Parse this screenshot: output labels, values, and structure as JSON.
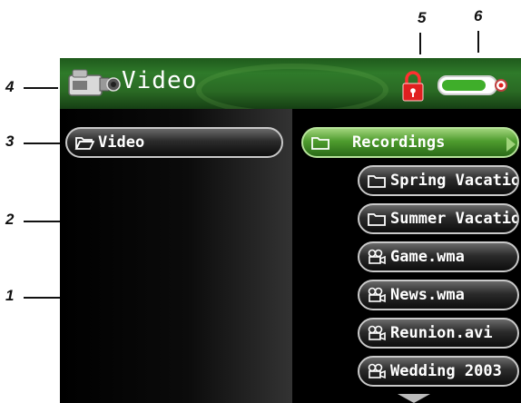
{
  "callouts": [
    "1",
    "2",
    "3",
    "4",
    "5",
    "6"
  ],
  "header": {
    "title": "Video",
    "locked": true,
    "battery_level": 0.85
  },
  "left_pane": {
    "folder_label": "Video"
  },
  "file_list": [
    {
      "label": "Recordings",
      "kind": "folder",
      "selected": true
    },
    {
      "label": "Spring Vacatio",
      "kind": "folder",
      "selected": false
    },
    {
      "label": "Summer Vacatio",
      "kind": "folder",
      "selected": false
    },
    {
      "label": "Game.wma",
      "kind": "video",
      "selected": false
    },
    {
      "label": "News.wma",
      "kind": "video",
      "selected": false
    },
    {
      "label": "Reunion.avi",
      "kind": "video",
      "selected": false
    },
    {
      "label": "Wedding 2003",
      "kind": "video",
      "selected": false
    }
  ],
  "colors": {
    "selected": "#4e9c2e",
    "titlebar": "#2f7a2a",
    "lock": "#e02020"
  },
  "icons": {
    "camcorder": "camcorder-icon",
    "lock": "lock-icon",
    "battery": "battery-icon",
    "folder": "folder-icon",
    "open_folder": "open-folder-icon",
    "video_file": "video-file-icon",
    "scroll_down": "scroll-down-icon"
  }
}
